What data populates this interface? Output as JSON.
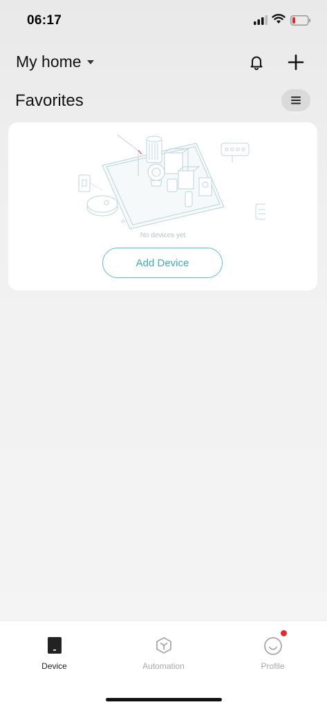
{
  "status_bar": {
    "time": "06:17",
    "icons": [
      "signal-icon",
      "wifi-icon",
      "battery-low-icon"
    ]
  },
  "header": {
    "home_name": "My home",
    "icons": [
      "dropdown-caret-icon",
      "bell-icon",
      "plus-icon"
    ]
  },
  "favorites": {
    "title": "Favorites",
    "menu_icon": "list-menu-icon"
  },
  "empty_state": {
    "message": "No devices yet",
    "button_label": "Add Device",
    "illustration": "smart-home-devices-illustration"
  },
  "tabs": [
    {
      "label": "Device",
      "icon": "device-icon",
      "active": true
    },
    {
      "label": "Automation",
      "icon": "automation-cube-icon",
      "active": false
    },
    {
      "label": "Profile",
      "icon": "profile-smile-icon",
      "active": false,
      "badge": true
    }
  ],
  "colors": {
    "accent": "#3aaeb0",
    "badge": "#e8262d",
    "battery_low": "#e8262d"
  }
}
